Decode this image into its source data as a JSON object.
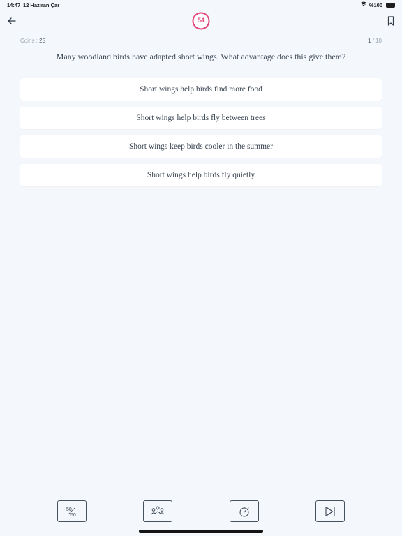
{
  "status_bar": {
    "time": "14:47",
    "date": "12 Haziran Çar",
    "battery": "%100"
  },
  "header": {
    "back_icon": "arrow-left-icon",
    "bookmark_icon": "bookmark-icon",
    "timer_value": "54",
    "timer_color": "#e3467a"
  },
  "stats": {
    "coins_label": "Coins :",
    "coins_value": "25",
    "progress_current": "1",
    "progress_total": "/ 10"
  },
  "question": {
    "text": "Many woodland birds have adapted short wings. What advantage does this give them?"
  },
  "options": [
    "Short wings help birds find more food",
    "Short wings help birds fly between trees",
    "Short wings keep birds cooler in the summer",
    "Short wings help birds fly quietly"
  ],
  "lifelines": [
    {
      "icon": "fifty-fifty-icon"
    },
    {
      "icon": "audience-icon"
    },
    {
      "icon": "timer-icon"
    },
    {
      "icon": "skip-icon"
    }
  ]
}
